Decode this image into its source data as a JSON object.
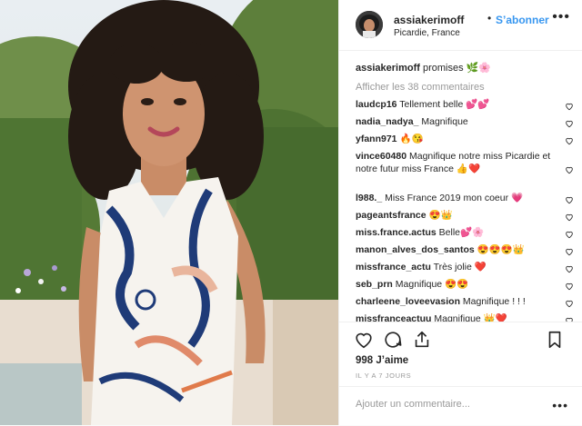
{
  "post": {
    "username": "assiakerimoff",
    "separator": "•",
    "follow_label": "S’abonner",
    "location": "Picardie, France",
    "more_glyph": "•••"
  },
  "caption": {
    "username": "assiakerimoff",
    "text": "promises 🌿🌸"
  },
  "view_all": "Afficher les 38 commentaires",
  "comments": [
    {
      "user": "laudcp16",
      "text": "Tellement belle 💕💕"
    },
    {
      "user": "nadia_nadya_",
      "text": "Magnifique"
    },
    {
      "user": "yfann971",
      "text": "🔥😘"
    },
    {
      "user": "vince60480",
      "text": "Magnifique notre miss Picardie et notre futur miss France 👍❤️"
    },
    {
      "user": "l988._",
      "text": "Miss France 2019 mon coeur 💗"
    },
    {
      "user": "pageantsfrance",
      "text": "😍👑"
    },
    {
      "user": "miss.france.actus",
      "text": "Belle💕🌸"
    },
    {
      "user": "manon_alves_dos_santos",
      "text": "😍😍😍👑"
    },
    {
      "user": "missfrance_actu",
      "text": "Très jolie ❤️"
    },
    {
      "user": "seb_prn",
      "text": "Magnifique 😍😍"
    },
    {
      "user": "charleene_loveevasion",
      "text": "Magnifique ! ! !"
    },
    {
      "user": "missfranceactuu",
      "text": "Magnifique 👑❤️"
    }
  ],
  "likes": "998 J’aime",
  "timestamp": "IL Y A 7 JOURS",
  "add_comment_placeholder": "Ajouter un commentaire...",
  "add_comment_more": "•••",
  "colors": {
    "link": "#3897f0",
    "text": "#262626",
    "muted": "#999999",
    "border": "#efefef"
  }
}
